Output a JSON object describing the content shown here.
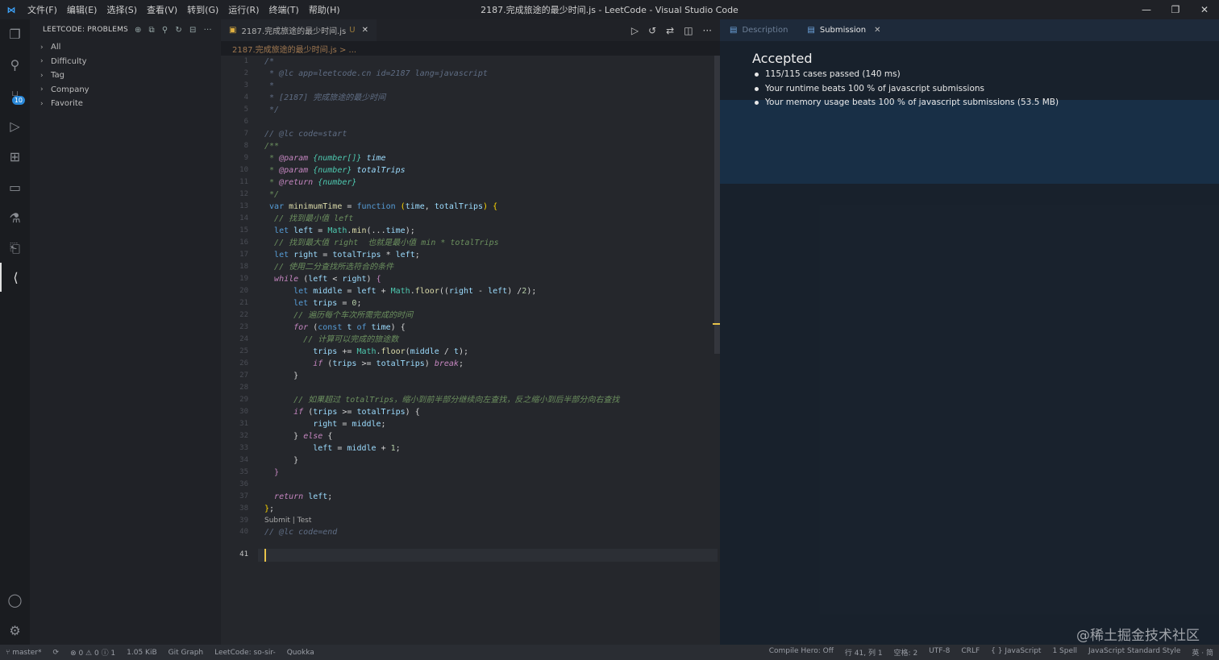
{
  "titlebar": {
    "menu": [
      "文件(F)",
      "编辑(E)",
      "选择(S)",
      "查看(V)",
      "转到(G)",
      "运行(R)",
      "终端(T)",
      "帮助(H)"
    ],
    "window_title": "2187.完成旅途的最少时间.js - LeetCode - Visual Studio Code",
    "minimize": "—",
    "restore": "❐",
    "close": "✕"
  },
  "activity": {
    "scm_badge": "10"
  },
  "sidebar": {
    "header": "LEETCODE: PROBLEMS",
    "tree": [
      "All",
      "Difficulty",
      "Tag",
      "Company",
      "Favorite"
    ]
  },
  "editor": {
    "tab_label": "2187.完成旅途的最少时间.js",
    "tab_modified": "U",
    "tab_close": "✕",
    "breadcrumb": "2187.完成旅途的最少时间.js > ...",
    "line_numbers": [
      "1",
      "2",
      "3",
      "4",
      "5",
      "6",
      "7",
      "8",
      "9",
      "10",
      "11",
      "12",
      "13",
      "14",
      "15",
      "16",
      "17",
      "18",
      "19",
      "20",
      "21",
      "22",
      "23",
      "24",
      "25",
      "26",
      "27",
      "28",
      "29",
      "30",
      "31",
      "32",
      "33",
      "34",
      "35",
      "36",
      "37",
      "38",
      "39",
      "40",
      "41"
    ],
    "current_line": "41",
    "codelens": "Submit | Test"
  },
  "rightpanel": {
    "tab_description": "Description",
    "tab_submission": "Submission",
    "tab_close": "✕",
    "status": "Accepted",
    "results": [
      "115/115 cases passed (140 ms)",
      "Your runtime beats 100 % of javascript submissions",
      "Your memory usage beats 100 % of javascript submissions (53.5 MB)"
    ],
    "watermark": "@稀土掘金技术社区"
  },
  "statusbar": {
    "branch": "master*",
    "sync": "⟳",
    "problems": "⊗ 0 ⚠ 0 ⓘ 1",
    "size": "1.05 KiB",
    "git_graph": "Git Graph",
    "leetcode_user": "LeetCode: so-sir-",
    "quokka": "Quokka",
    "compile_hero": "Compile Hero: Off",
    "position": "行 41, 列 1",
    "spaces": "空格: 2",
    "encoding": "UTF-8",
    "eol": "CRLF",
    "language": "{ } JavaScript",
    "spell": "1 Spell",
    "style": "JavaScript Standard Style",
    "ime": "英 · 简"
  },
  "colors": {
    "accent": "#3ea6ff",
    "accepted": "#f0f0f0",
    "background": "#1b1d22"
  }
}
